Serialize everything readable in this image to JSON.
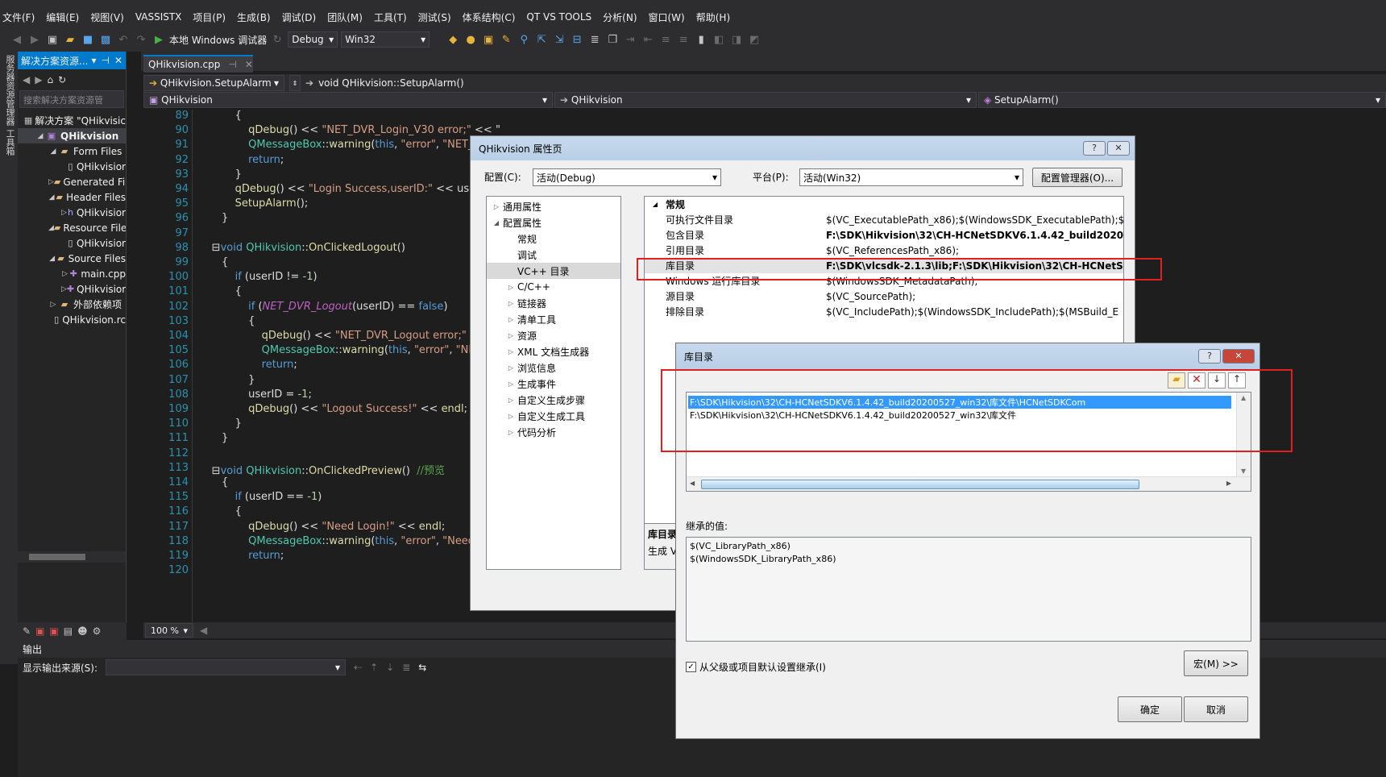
{
  "menu": [
    "文件(F)",
    "编辑(E)",
    "视图(V)",
    "VASSISTX",
    "项目(P)",
    "生成(B)",
    "调试(D)",
    "团队(M)",
    "工具(T)",
    "测试(S)",
    "体系结构(C)",
    "QT VS TOOLS",
    "分析(N)",
    "窗口(W)",
    "帮助(H)"
  ],
  "toolbar": {
    "run_label": "本地 Windows 调试器",
    "config": "Debug",
    "platform": "Win32"
  },
  "left_strip": [
    "服务器资源管理器",
    "工具箱"
  ],
  "solution": {
    "title": "解决方案资源...",
    "search_placeholder": "搜索解决方案资源管",
    "items": [
      {
        "label": "解决方案 \"QHikvisic",
        "icon": "solution-icon",
        "indent": 0,
        "arrow": ""
      },
      {
        "label": "QHikvision",
        "icon": "project-icon",
        "indent": 1,
        "arrow": "◢",
        "bold": true
      },
      {
        "label": "Form Files",
        "icon": "folder-icon",
        "indent": 2,
        "arrow": "◢"
      },
      {
        "label": "QHikvisior",
        "icon": "file-icon",
        "indent": 3,
        "arrow": ""
      },
      {
        "label": "Generated Fil",
        "icon": "folder-icon",
        "indent": 2,
        "arrow": "▷"
      },
      {
        "label": "Header Files",
        "icon": "folder-icon",
        "indent": 2,
        "arrow": "◢"
      },
      {
        "label": "QHikvisior",
        "icon": "header-file-icon",
        "indent": 3,
        "arrow": "▷"
      },
      {
        "label": "Resource File",
        "icon": "folder-icon",
        "indent": 2,
        "arrow": "◢"
      },
      {
        "label": "QHikvisior",
        "icon": "file-icon",
        "indent": 3,
        "arrow": ""
      },
      {
        "label": "Source Files",
        "icon": "folder-icon",
        "indent": 2,
        "arrow": "◢"
      },
      {
        "label": "main.cpp",
        "icon": "cpp-file-icon",
        "indent": 3,
        "arrow": "▷"
      },
      {
        "label": "QHikvisior",
        "icon": "cpp-file-icon",
        "indent": 3,
        "arrow": "▷"
      },
      {
        "label": "外部依赖项",
        "icon": "folder-icon",
        "indent": 2,
        "arrow": "▷"
      },
      {
        "label": "QHikvision.rc",
        "icon": "file-icon",
        "indent": 2,
        "arrow": ""
      }
    ]
  },
  "editor": {
    "tab": "QHikvision.cpp",
    "nav_member": "QHikvision.SetupAlarm",
    "nav_func": "void QHikvision::SetupAlarm()",
    "nav_class": "QHikvision",
    "nav_class2": "QHikvision",
    "nav_method": "SetupAlarm()",
    "zoom": "100 %",
    "lines": [
      {
        "n": "89",
        "t": [
          [
            "ident",
            "            {"
          ]
        ]
      },
      {
        "n": "90",
        "t": [
          [
            "ident",
            "                "
          ],
          [
            "fn",
            "qDebug"
          ],
          [
            "ident",
            "() << "
          ],
          [
            "str",
            "\"NET_DVR_Login_V30 error;\""
          ],
          [
            "ident",
            " << \""
          ]
        ]
      },
      {
        "n": "91",
        "t": [
          [
            "ident",
            "                "
          ],
          [
            "cls",
            "QMessageBox"
          ],
          [
            "ident",
            "::"
          ],
          [
            "fn",
            "warning"
          ],
          [
            "ident",
            "("
          ],
          [
            "kw",
            "this"
          ],
          [
            "ident",
            ", "
          ],
          [
            "str",
            "\"error\""
          ],
          [
            "ident",
            ", "
          ],
          [
            "str",
            "\"NET_DVR"
          ]
        ]
      },
      {
        "n": "92",
        "t": [
          [
            "ident",
            "                "
          ],
          [
            "kw",
            "return"
          ],
          [
            "ident",
            ";"
          ]
        ]
      },
      {
        "n": "93",
        "t": [
          [
            "ident",
            "            }"
          ]
        ]
      },
      {
        "n": "94",
        "t": [
          [
            "ident",
            "            "
          ],
          [
            "fn",
            "qDebug"
          ],
          [
            "ident",
            "() << "
          ],
          [
            "str",
            "\"Login Success,userID:\""
          ],
          [
            "ident",
            " << userID <"
          ]
        ]
      },
      {
        "n": "95",
        "t": [
          [
            "ident",
            "            "
          ],
          [
            "fn",
            "SetupAlarm"
          ],
          [
            "ident",
            "();"
          ]
        ]
      },
      {
        "n": "96",
        "t": [
          [
            "ident",
            "        }"
          ]
        ]
      },
      {
        "n": "97",
        "t": [
          [
            "ident",
            ""
          ]
        ]
      },
      {
        "n": "98",
        "t": [
          [
            "ident",
            "     ⊟"
          ],
          [
            "kw",
            "void "
          ],
          [
            "cls",
            "QHikvision"
          ],
          [
            "ident",
            "::"
          ],
          [
            "fn",
            "OnClickedLogout"
          ],
          [
            "ident",
            "()"
          ]
        ]
      },
      {
        "n": "99",
        "t": [
          [
            "ident",
            "        {"
          ]
        ]
      },
      {
        "n": "100",
        "t": [
          [
            "ident",
            "            "
          ],
          [
            "kw",
            "if"
          ],
          [
            "ident",
            " (userID != "
          ],
          [
            "num",
            "-1"
          ],
          [
            "ident",
            ")"
          ]
        ]
      },
      {
        "n": "101",
        "t": [
          [
            "ident",
            "            {"
          ]
        ]
      },
      {
        "n": "102",
        "t": [
          [
            "ident",
            "                "
          ],
          [
            "kw",
            "if"
          ],
          [
            "ident",
            " ("
          ],
          [
            "mac",
            "NET_DVR_Logout"
          ],
          [
            "ident",
            "(userID) == "
          ],
          [
            "kw",
            "false"
          ],
          [
            "ident",
            ")"
          ]
        ]
      },
      {
        "n": "103",
        "t": [
          [
            "ident",
            "                {"
          ]
        ]
      },
      {
        "n": "104",
        "t": [
          [
            "ident",
            "                    "
          ],
          [
            "fn",
            "qDebug"
          ],
          [
            "ident",
            "() << "
          ],
          [
            "str",
            "\"NET_DVR_Logout error;\""
          ],
          [
            "ident",
            " << \""
          ]
        ]
      },
      {
        "n": "105",
        "t": [
          [
            "ident",
            "                    "
          ],
          [
            "cls",
            "QMessageBox"
          ],
          [
            "ident",
            "::"
          ],
          [
            "fn",
            "warning"
          ],
          [
            "ident",
            "("
          ],
          [
            "kw",
            "this"
          ],
          [
            "ident",
            ", "
          ],
          [
            "str",
            "\"error\""
          ],
          [
            "ident",
            ", "
          ],
          [
            "str",
            "\"NET_DV"
          ]
        ]
      },
      {
        "n": "106",
        "t": [
          [
            "ident",
            "                    "
          ],
          [
            "kw",
            "return"
          ],
          [
            "ident",
            ";"
          ]
        ]
      },
      {
        "n": "107",
        "t": [
          [
            "ident",
            "                }"
          ]
        ]
      },
      {
        "n": "108",
        "t": [
          [
            "ident",
            "                userID = "
          ],
          [
            "num",
            "-1"
          ],
          [
            "ident",
            ";"
          ]
        ]
      },
      {
        "n": "109",
        "t": [
          [
            "ident",
            "                "
          ],
          [
            "fn",
            "qDebug"
          ],
          [
            "ident",
            "() << "
          ],
          [
            "str",
            "\"Logout Success!\""
          ],
          [
            "ident",
            " << "
          ],
          [
            "fn",
            "endl"
          ],
          [
            "ident",
            ";"
          ]
        ]
      },
      {
        "n": "110",
        "t": [
          [
            "ident",
            "            }"
          ]
        ]
      },
      {
        "n": "111",
        "t": [
          [
            "ident",
            "        }"
          ]
        ]
      },
      {
        "n": "112",
        "t": [
          [
            "ident",
            ""
          ]
        ]
      },
      {
        "n": "113",
        "t": [
          [
            "ident",
            "     ⊟"
          ],
          [
            "kw",
            "void "
          ],
          [
            "cls",
            "QHikvision"
          ],
          [
            "ident",
            "::"
          ],
          [
            "fn",
            "OnClickedPreview"
          ],
          [
            "ident",
            "()  "
          ],
          [
            "cm",
            "//预览"
          ]
        ]
      },
      {
        "n": "114",
        "t": [
          [
            "ident",
            "        {"
          ]
        ]
      },
      {
        "n": "115",
        "t": [
          [
            "ident",
            "            "
          ],
          [
            "kw",
            "if"
          ],
          [
            "ident",
            " (userID == "
          ],
          [
            "num",
            "-1"
          ],
          [
            "ident",
            ")"
          ]
        ]
      },
      {
        "n": "116",
        "t": [
          [
            "ident",
            "            {"
          ]
        ]
      },
      {
        "n": "117",
        "t": [
          [
            "ident",
            "                "
          ],
          [
            "fn",
            "qDebug"
          ],
          [
            "ident",
            "() << "
          ],
          [
            "str",
            "\"Need Login!\""
          ],
          [
            "ident",
            " << "
          ],
          [
            "fn",
            "endl"
          ],
          [
            "ident",
            ";"
          ]
        ]
      },
      {
        "n": "118",
        "t": [
          [
            "ident",
            "                "
          ],
          [
            "cls",
            "QMessageBox"
          ],
          [
            "ident",
            "::"
          ],
          [
            "fn",
            "warning"
          ],
          [
            "ident",
            "("
          ],
          [
            "kw",
            "this"
          ],
          [
            "ident",
            ", "
          ],
          [
            "str",
            "\"error\""
          ],
          [
            "ident",
            ", "
          ],
          [
            "str",
            "\"Need Logi"
          ]
        ]
      },
      {
        "n": "119",
        "t": [
          [
            "ident",
            "                "
          ],
          [
            "kw",
            "return"
          ],
          [
            "ident",
            ";"
          ]
        ]
      },
      {
        "n": "120",
        "t": [
          [
            "ident",
            ""
          ]
        ]
      }
    ]
  },
  "output": {
    "title": "输出",
    "source_label": "显示输出来源(S):"
  },
  "propdlg": {
    "title": "QHikvision 属性页",
    "config_label": "配置(C):",
    "config_value": "活动(Debug)",
    "platform_label": "平台(P):",
    "platform_value": "活动(Win32)",
    "manager_button": "配置管理器(O)...",
    "tree": [
      {
        "label": "通用属性",
        "arrow": "▷",
        "indent": 0
      },
      {
        "label": "配置属性",
        "arrow": "◢",
        "indent": 0
      },
      {
        "label": "常规",
        "arrow": "",
        "indent": 1
      },
      {
        "label": "调试",
        "arrow": "",
        "indent": 1
      },
      {
        "label": "VC++ 目录",
        "arrow": "",
        "indent": 1,
        "selected": true
      },
      {
        "label": "C/C++",
        "arrow": "▷",
        "indent": 1
      },
      {
        "label": "链接器",
        "arrow": "▷",
        "indent": 1
      },
      {
        "label": "清单工具",
        "arrow": "▷",
        "indent": 1
      },
      {
        "label": "资源",
        "arrow": "▷",
        "indent": 1
      },
      {
        "label": "XML 文档生成器",
        "arrow": "▷",
        "indent": 1
      },
      {
        "label": "浏览信息",
        "arrow": "▷",
        "indent": 1
      },
      {
        "label": "生成事件",
        "arrow": "▷",
        "indent": 1
      },
      {
        "label": "自定义生成步骤",
        "arrow": "▷",
        "indent": 1
      },
      {
        "label": "自定义生成工具",
        "arrow": "▷",
        "indent": 1
      },
      {
        "label": "代码分析",
        "arrow": "▷",
        "indent": 1
      }
    ],
    "grid_section": "常规",
    "grid": [
      {
        "k": "可执行文件目录",
        "v": "$(VC_ExecutablePath_x86);$(WindowsSDK_ExecutablePath);$"
      },
      {
        "k": "包含目录",
        "v": "F:\\SDK\\Hikvision\\32\\CH-HCNetSDKV6.1.4.42_build20200",
        "bold": true
      },
      {
        "k": "引用目录",
        "v": "$(VC_ReferencesPath_x86);"
      },
      {
        "k": "库目录",
        "v": "F:\\SDK\\vlcsdk-2.1.3\\lib;F:\\SDK\\Hikvision\\32\\CH-HCNetS",
        "bold": true,
        "selected": true
      },
      {
        "k": "Windows 运行库目录",
        "v": "$(WindowsSDK_MetadataPath);"
      },
      {
        "k": "源目录",
        "v": "$(VC_SourcePath);"
      },
      {
        "k": "排除目录",
        "v": "$(VC_IncludePath);$(WindowsSDK_IncludePath);$(MSBuild_E"
      }
    ],
    "desc_title": "库目录",
    "desc_text": "生成 V"
  },
  "libdlg": {
    "title": "库目录",
    "entries": [
      "F:\\SDK\\Hikvision\\32\\CH-HCNetSDKV6.1.4.42_build20200527_win32\\库文件\\HCNetSDKCom",
      "F:\\SDK\\Hikvision\\32\\CH-HCNetSDKV6.1.4.42_build20200527_win32\\库文件"
    ],
    "inherited_label": "继承的值:",
    "inherited": [
      "$(VC_LibraryPath_x86)",
      "$(WindowsSDK_LibraryPath_x86)"
    ],
    "inherit_checkbox": "从父级或项目默认设置继承(I)",
    "macro_button": "宏(M) >>",
    "ok_button": "确定",
    "cancel_button": "取消"
  }
}
